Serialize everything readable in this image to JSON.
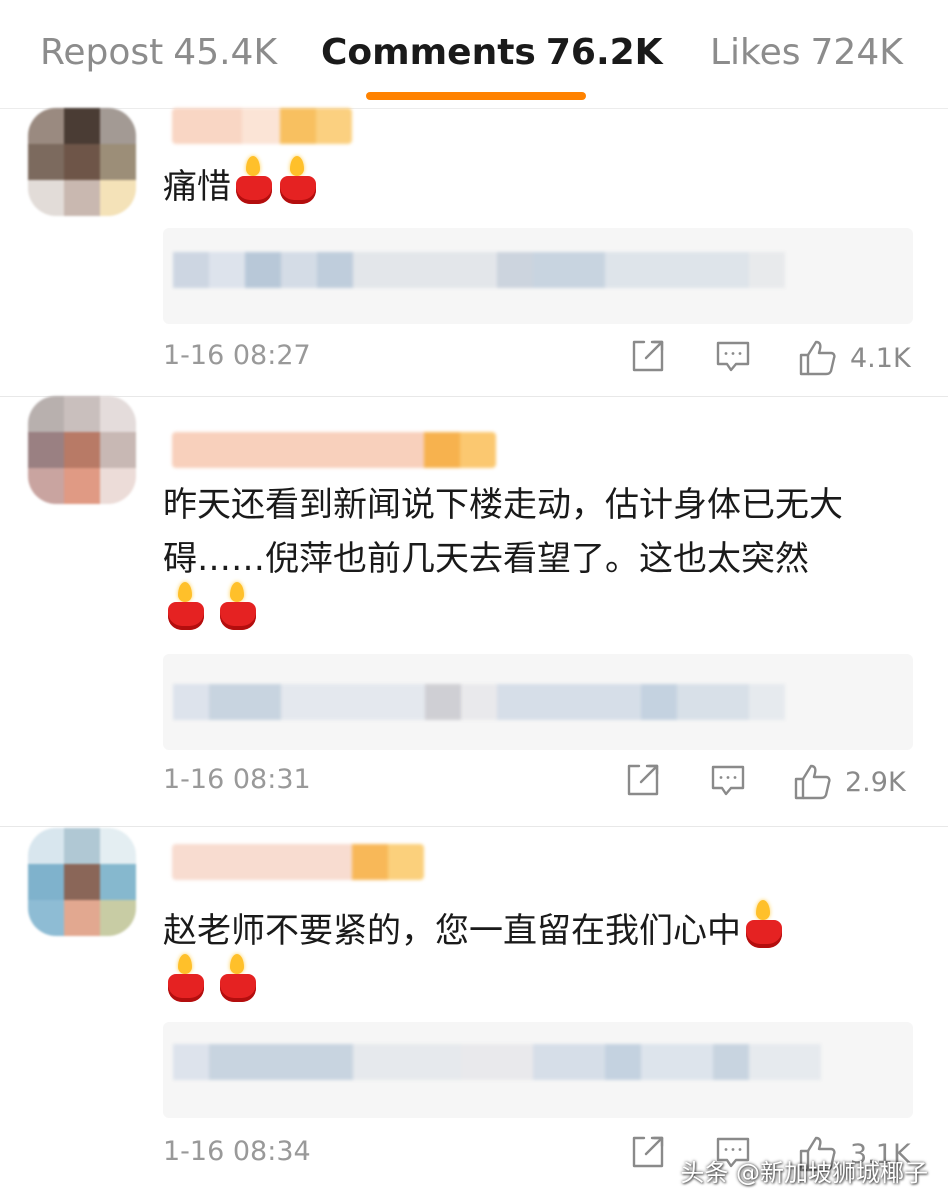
{
  "tabs": [
    {
      "label": "Repost",
      "count": "45.4K"
    },
    {
      "label": "Comments",
      "count": "76.2K"
    },
    {
      "label": "Likes",
      "count": "724K"
    }
  ],
  "active_tab": "Comments",
  "accent_color": "#ff8200",
  "icons": {
    "repost": "repost-icon",
    "comment": "comment-icon",
    "like": "thumbs-up-icon",
    "emoji": "candle-emoji"
  },
  "comments": [
    {
      "text": "痛惜",
      "emoji_count": 2,
      "time": "1-16 08:27",
      "likes": "4.1K"
    },
    {
      "text": "昨天还看到新闻说下楼走动，估计身体已无大碍……倪萍也前几天去看望了。这也太突然",
      "emoji_count": 2,
      "time": "1-16 08:31",
      "likes": "2.9K"
    },
    {
      "text": "赵老师不要紧的，您一直留在我们心中",
      "emoji_count": 3,
      "time": "1-16 08:34",
      "likes": "3.1K"
    }
  ],
  "watermark": "头条 @新加坡狮城椰子"
}
